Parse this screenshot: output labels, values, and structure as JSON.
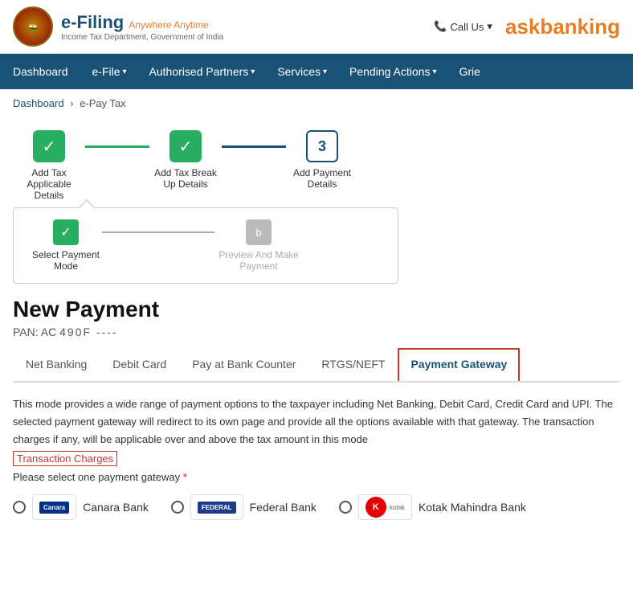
{
  "header": {
    "logo_efiling": "e-Filing",
    "logo_tagline": "Anywhere Anytime",
    "logo_subtitle": "Income Tax Department, Government of India",
    "call_us": "Call Us",
    "askbanking": "askbanking"
  },
  "nav": {
    "items": [
      {
        "label": "Dashboard",
        "has_arrow": false
      },
      {
        "label": "e-File",
        "has_arrow": true
      },
      {
        "label": "Authorised Partners",
        "has_arrow": true
      },
      {
        "label": "Services",
        "has_arrow": true
      },
      {
        "label": "Pending Actions",
        "has_arrow": true
      },
      {
        "label": "Grie",
        "has_arrow": false
      }
    ]
  },
  "breadcrumb": {
    "home": "Dashboard",
    "separator": ">",
    "current": "e-Pay Tax"
  },
  "steps": [
    {
      "id": 1,
      "label": "Add Tax Applicable Details",
      "state": "done"
    },
    {
      "id": 2,
      "label": "Add Tax Break Up Details",
      "state": "done"
    },
    {
      "id": 3,
      "label": "Add Payment Details",
      "state": "active"
    }
  ],
  "substeps": [
    {
      "id": "a",
      "label": "Select Payment Mode",
      "state": "done"
    },
    {
      "id": "b",
      "label": "Preview And Make Payment",
      "state": "gray"
    }
  ],
  "payment": {
    "title": "New Payment",
    "pan_label": "PAN: AC",
    "pan_value": "490F ---- "
  },
  "tabs": [
    {
      "label": "Net Banking",
      "active": false
    },
    {
      "label": "Debit Card",
      "active": false
    },
    {
      "label": "Pay at Bank Counter",
      "active": false
    },
    {
      "label": "RTGS/NEFT",
      "active": false
    },
    {
      "label": "Payment Gateway",
      "active": true
    }
  ],
  "tab_content": {
    "description": "This mode provides a wide range of payment options to the taxpayer including Net Banking, Debit Card, Credit Card and UPI. The selected payment gateway will redirect to its own page and provide all the options available with that gateway. The transaction charges if any, will be applicable over and above the tax amount in this mode",
    "transaction_charges_label": "Transaction Charges",
    "select_gateway_label": "Please select one payment gateway",
    "required_mark": "*"
  },
  "bank_options": [
    {
      "name": "Canara Bank",
      "logo_text": "Canara Bank",
      "logo_color": "#003087"
    },
    {
      "name": "Federal Bank",
      "logo_text": "Federal Bank",
      "logo_color": "#1e3a8a"
    },
    {
      "name": "Kotak Mahindra Bank",
      "logo_text": "kotak",
      "logo_color": "#e60000"
    }
  ]
}
